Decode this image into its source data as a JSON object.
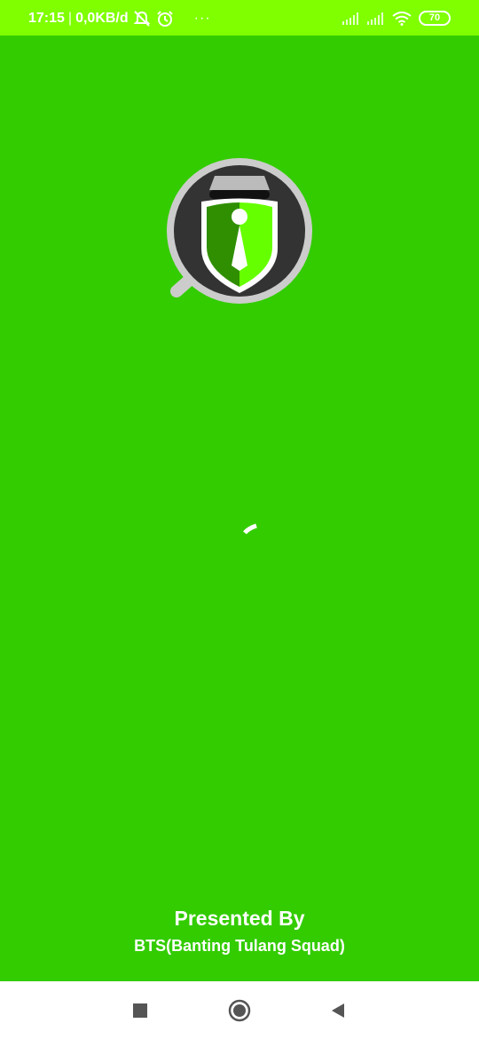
{
  "status_bar": {
    "time": "17:15",
    "separator": "|",
    "network_speed": "0,0KB/d",
    "more_indicator": "···",
    "battery_level": "70",
    "icons": [
      "notifications-off-icon",
      "alarm-icon",
      "signal-icon",
      "signal-icon",
      "wifi-icon",
      "battery-icon"
    ],
    "background_color": "#7fff00"
  },
  "app": {
    "background_color": "#33cc00",
    "logo_icon": "security-badge-logo-icon",
    "loading": true
  },
  "footer": {
    "presented_by": "Presented By",
    "credit": "BTS(Banting Tulang Squad)"
  },
  "nav_bar": {
    "recent_icon": "square-icon",
    "home_icon": "circle-icon",
    "back_icon": "triangle-back-icon"
  }
}
